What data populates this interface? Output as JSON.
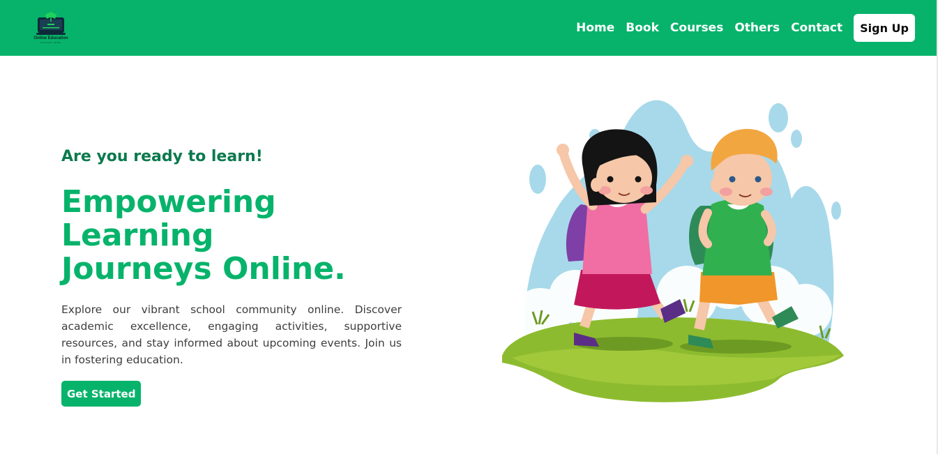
{
  "navbar": {
    "logo": {
      "name": "Online Education",
      "tagline": "SLOGAN HERE"
    },
    "links": [
      "Home",
      "Book",
      "Courses",
      "Others",
      "Contact"
    ],
    "signup_label": "Sign Up"
  },
  "hero": {
    "subheading": "Are you ready to learn!",
    "heading_line1": "Empowering Learning",
    "heading_line2": "Journeys Online.",
    "description": "Explore our vibrant school community online. Discover academic excellence, engaging activities, supportive resources, and stay informed about upcoming events. Join us in fostering education.",
    "cta_label": "Get Started"
  },
  "colors": {
    "brand": "#07b36b",
    "subheading": "#0b7a4d",
    "text": "#3d3d3d"
  },
  "illustration": {
    "icon": "kids-with-backpacks-illustration"
  }
}
